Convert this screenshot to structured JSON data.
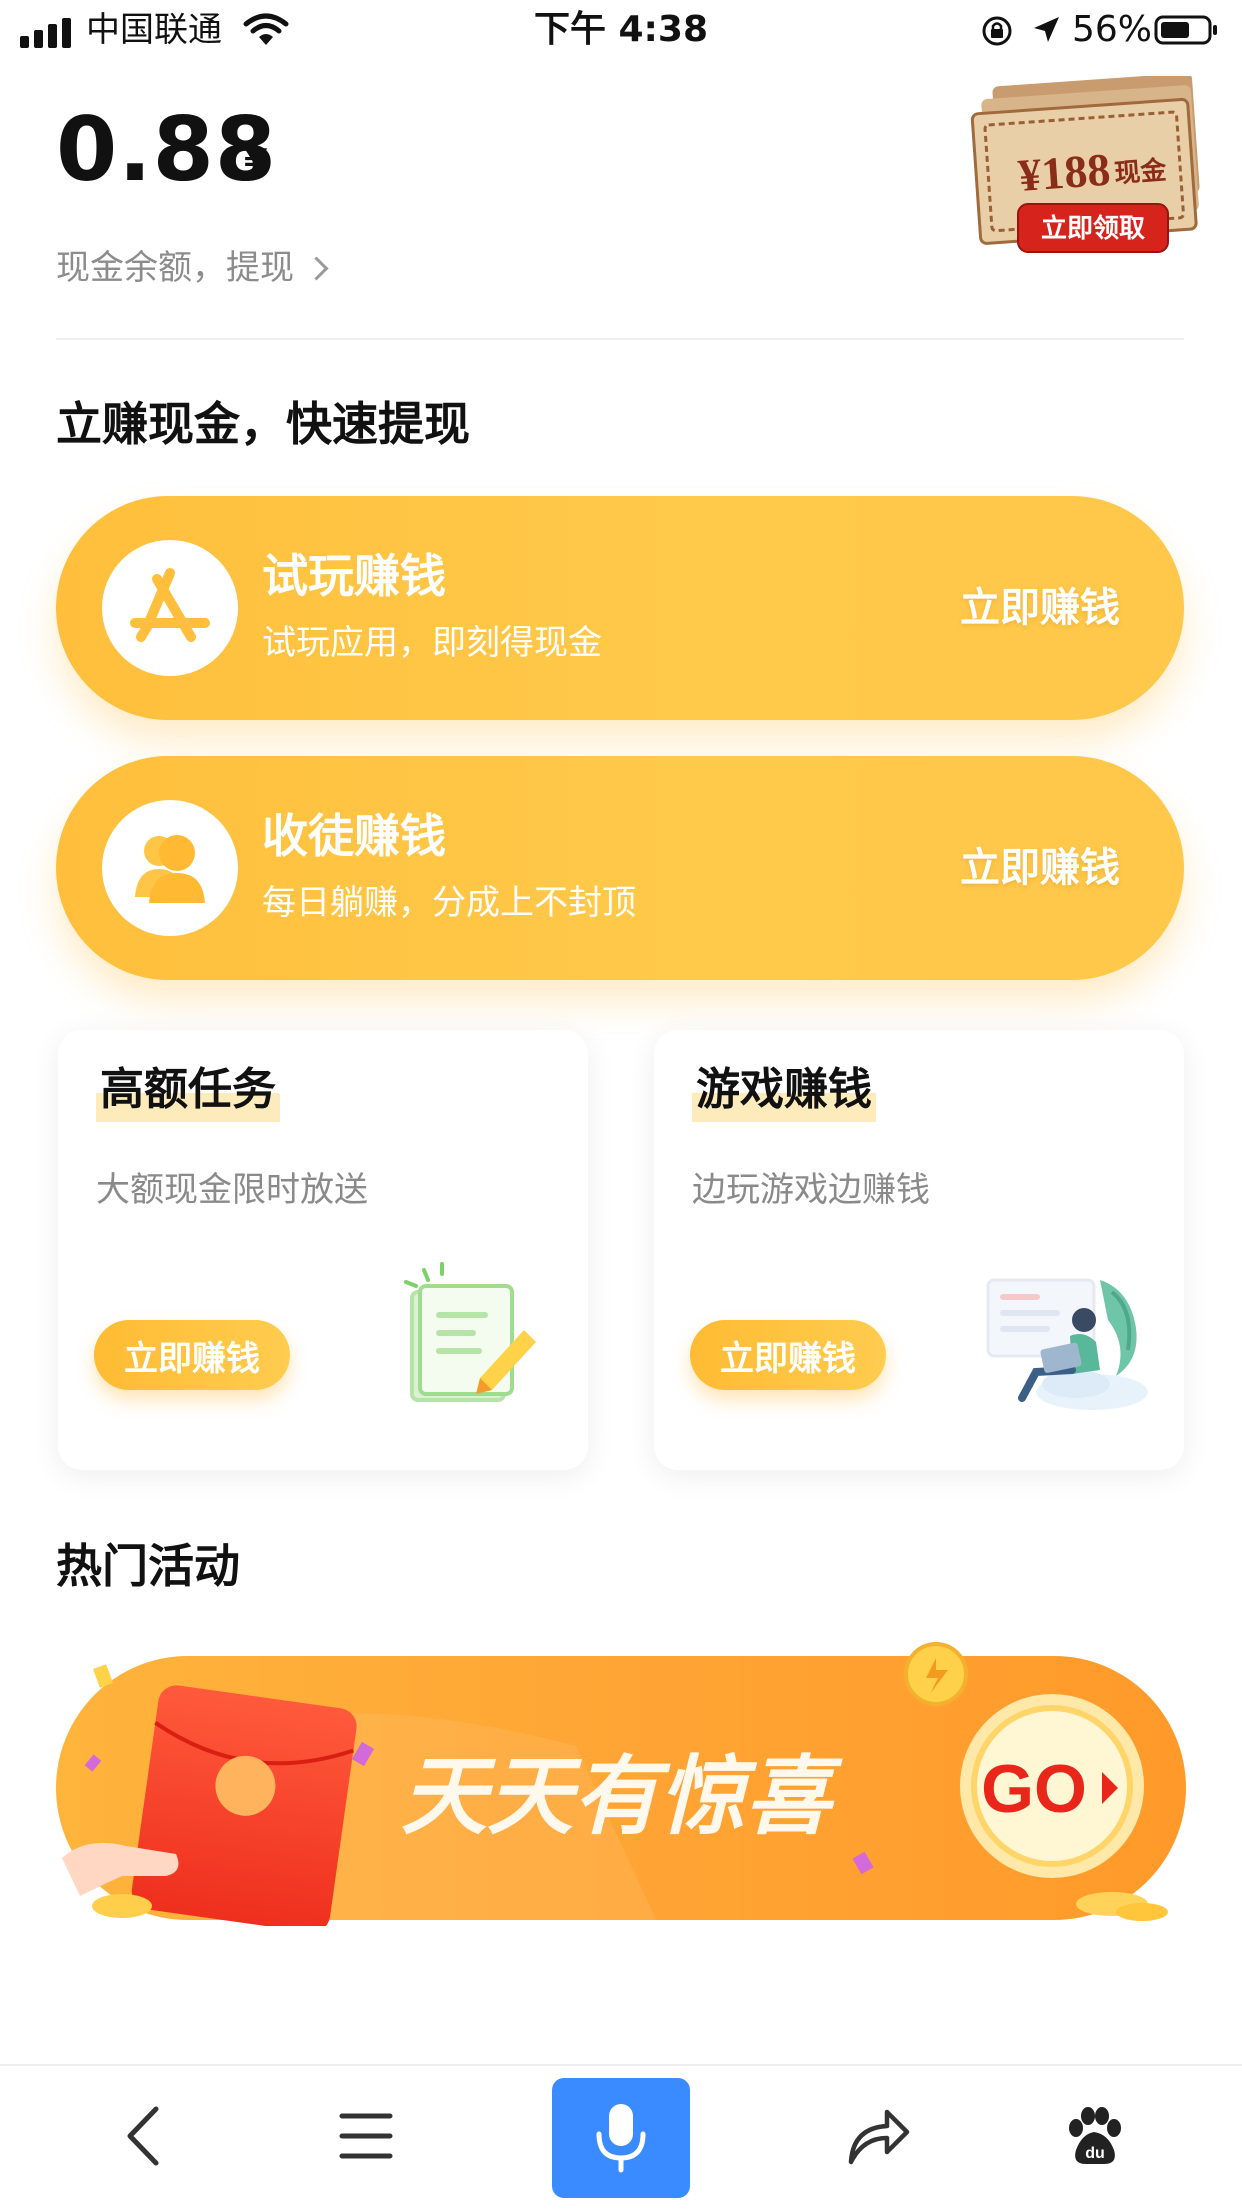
{
  "status_bar": {
    "carrier": "中国联通",
    "time": "下午 4:38",
    "battery": "56%"
  },
  "balance": {
    "amount": "0.88",
    "currency": "¥",
    "link_label": "现金余额，提现"
  },
  "promo_ticket": {
    "amount": "¥188",
    "amount_suffix": "现金",
    "button_label": "立即领取"
  },
  "earn_section": {
    "title": "立赚现金，快速提现",
    "cards": [
      {
        "title": "试玩赚钱",
        "subtitle": "试玩应用，即刻得现金",
        "action": "立即赚钱",
        "icon": "app-store-icon"
      },
      {
        "title": "收徒赚钱",
        "subtitle": "每日躺赚，分成上不封顶",
        "action": "立即赚钱",
        "icon": "person-icon"
      }
    ]
  },
  "task_cards": [
    {
      "title": "高额任务",
      "subtitle": "大额现金限时放送",
      "button": "立即赚钱",
      "illustration": "document-pencil-illustration"
    },
    {
      "title": "游戏赚钱",
      "subtitle": "边玩游戏边赚钱",
      "button": "立即赚钱",
      "illustration": "person-laptop-illustration"
    }
  ],
  "hot_section": {
    "title": "热门活动",
    "banner_text": "天天有惊喜",
    "banner_button": "GO"
  },
  "bottom_nav": {
    "items": [
      "back-icon",
      "menu-icon",
      "microphone-icon",
      "share-icon",
      "baidu-paw-icon"
    ]
  },
  "colors": {
    "accent_yellow": "#ffc444",
    "banner_orange": "#ff9f2e",
    "mic_blue": "#3a8bff"
  }
}
